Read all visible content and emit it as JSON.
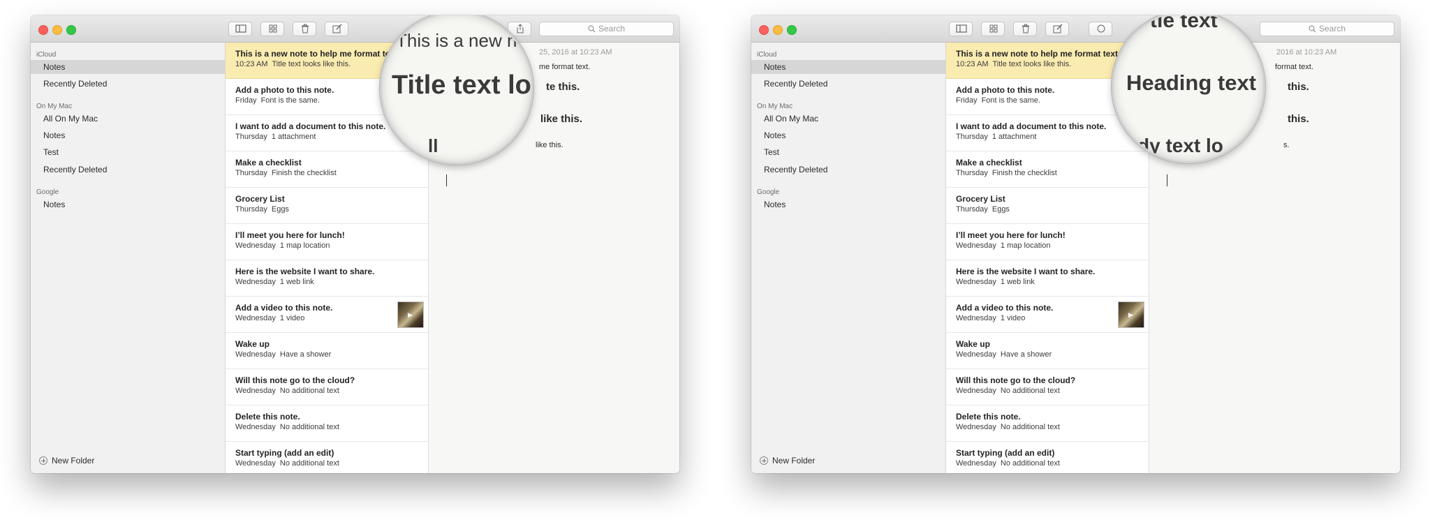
{
  "toolbar": {
    "search_placeholder": "Search"
  },
  "sidebar": {
    "sections": [
      {
        "label": "iCloud",
        "items": [
          "Notes",
          "Recently Deleted"
        ]
      },
      {
        "label": "On My Mac",
        "items": [
          "All On My Mac",
          "Notes",
          "Test",
          "Recently Deleted"
        ]
      },
      {
        "label": "Google",
        "items": [
          "Notes"
        ]
      }
    ],
    "new_folder": "New Folder"
  },
  "notes": [
    {
      "title": "This is a new note to help me format text.",
      "date": "10:23 AM",
      "snippet": "Title text looks like this."
    },
    {
      "title": "Add a photo to this note.",
      "date": "Friday",
      "snippet": "Font is the same."
    },
    {
      "title": "I want to add a document to this note.",
      "date": "Thursday",
      "snippet": "1 attachment"
    },
    {
      "title": "Make a checklist",
      "date": "Thursday",
      "snippet": "Finish the checklist"
    },
    {
      "title": "Grocery List",
      "date": "Thursday",
      "snippet": "Eggs"
    },
    {
      "title": "I’ll meet you here for lunch!",
      "date": "Wednesday",
      "snippet": "1 map location"
    },
    {
      "title": "Here is the website I want to share.",
      "date": "Wednesday",
      "snippet": "1 web link"
    },
    {
      "title": "Add a video to this note.",
      "date": "Wednesday",
      "snippet": "1 video"
    },
    {
      "title": "Wake up",
      "date": "Wednesday",
      "snippet": "Have a shower"
    },
    {
      "title": "Will this note go to the cloud?",
      "date": "Wednesday",
      "snippet": "No additional text"
    },
    {
      "title": "Delete this note.",
      "date": "Wednesday",
      "snippet": "No additional text"
    },
    {
      "title": "Start typing (add an edit)",
      "date": "Wednesday",
      "snippet": "No additional text"
    }
  ],
  "window1": {
    "editor": {
      "date": "25, 2016 at 10:23 AM",
      "line1": "me format text.",
      "line2": "te this.",
      "line3": "like this.",
      "line4": "like this."
    },
    "magnifier": {
      "top": "This is a new n",
      "main": "Title text lo",
      "bottom": "ll"
    }
  },
  "window2": {
    "editor": {
      "date": "2016 at 10:23 AM",
      "line1": "format text.",
      "line2": "this.",
      "line3": "this.",
      "line4": "s."
    },
    "magnifier": {
      "top": "tle text",
      "main": "Heading text",
      "bottom": "dy text lo"
    }
  }
}
